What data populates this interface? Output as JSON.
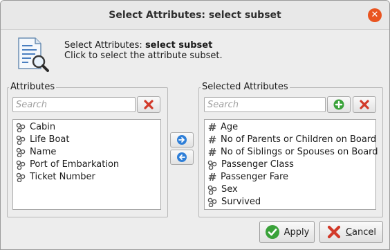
{
  "window": {
    "title": "Select Attributes: select subset"
  },
  "header": {
    "icon": "document-search-icon",
    "line1_prefix": "Select Attributes: ",
    "line1_bold": "select subset",
    "line2": "Click to select the attribute subset."
  },
  "attributes": {
    "title": "Attributes",
    "search_placeholder": "Search",
    "items": [
      {
        "label": "Cabin",
        "icon": "nominal-icon"
      },
      {
        "label": "Life Boat",
        "icon": "nominal-icon"
      },
      {
        "label": "Name",
        "icon": "nominal-icon"
      },
      {
        "label": "Port of Embarkation",
        "icon": "nominal-icon"
      },
      {
        "label": "Ticket Number",
        "icon": "nominal-icon"
      }
    ]
  },
  "selected": {
    "title": "Selected Attributes",
    "search_placeholder": "Search",
    "items": [
      {
        "label": "Age",
        "icon": "numeric-icon"
      },
      {
        "label": "No of Parents or Children on Board",
        "icon": "numeric-icon"
      },
      {
        "label": "No of Siblings or Spouses on Board",
        "icon": "numeric-icon"
      },
      {
        "label": "Passenger Class",
        "icon": "nominal-icon"
      },
      {
        "label": "Passenger Fare",
        "icon": "numeric-icon"
      },
      {
        "label": "Sex",
        "icon": "nominal-icon"
      },
      {
        "label": "Survived",
        "icon": "nominal-icon"
      }
    ]
  },
  "buttons": {
    "apply": "Apply",
    "cancel_accel": "C",
    "cancel_rest": "ancel"
  },
  "colors": {
    "close_button": "#e95420",
    "add_green": "#3aa23a",
    "remove_red": "#d23a2a",
    "arrow_blue": "#2f7fd8"
  }
}
